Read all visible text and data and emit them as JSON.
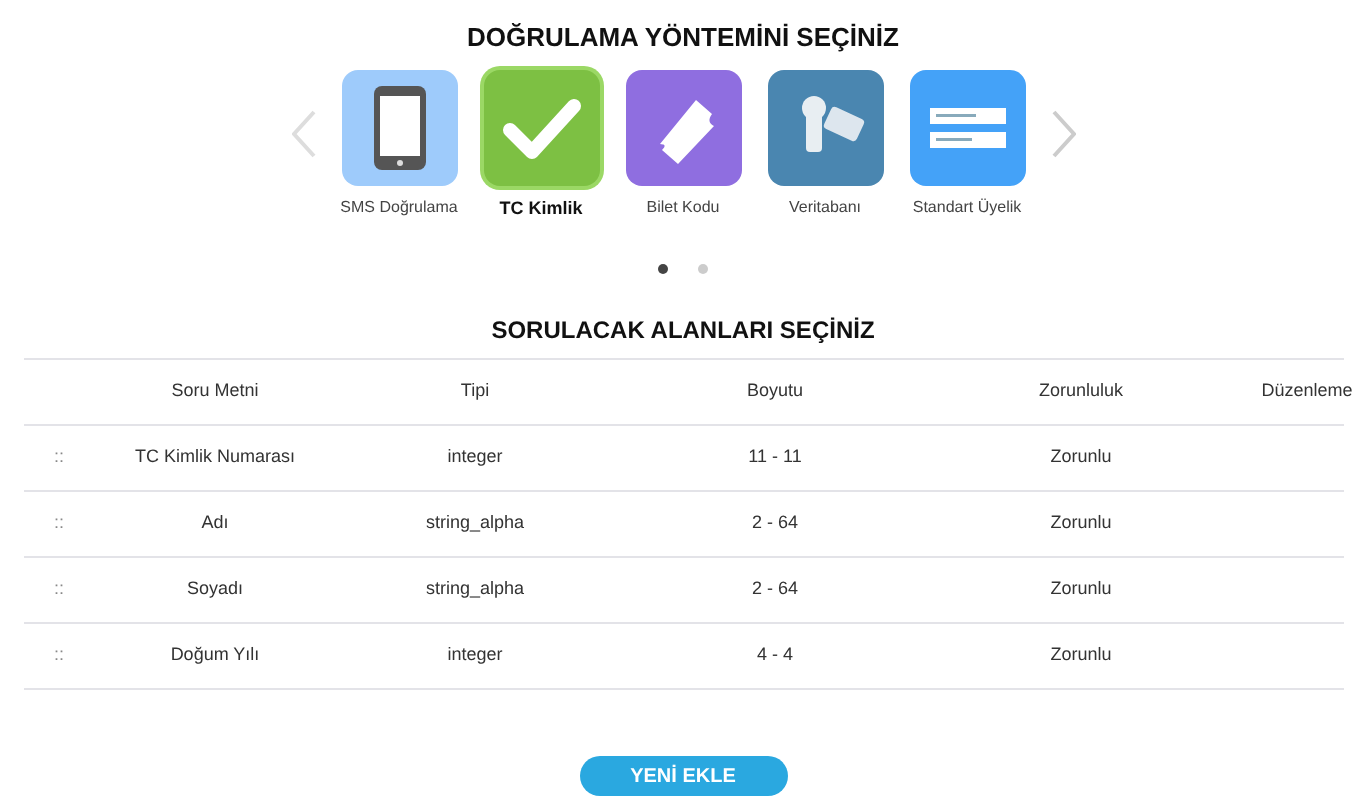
{
  "method_title": "DOĞRULAMA YÖNTEMİNİ SEÇİNİZ",
  "methods": [
    {
      "kind": "phone",
      "label": "SMS Doğrulama",
      "selected": false
    },
    {
      "kind": "check",
      "label": "TC Kimlik",
      "selected": true
    },
    {
      "kind": "ticket",
      "label": "Bilet Kodu",
      "selected": false
    },
    {
      "kind": "keys",
      "label": "Veritabanı",
      "selected": false
    },
    {
      "kind": "form",
      "label": "Standart Üyelik",
      "selected": false
    }
  ],
  "pages": [
    {
      "selected": true
    },
    {
      "selected": false
    }
  ],
  "fields_title": "SORULACAK ALANLARI SEÇİNİZ",
  "table": {
    "columns": [
      "Soru Metni",
      "Tipi",
      "Boyutu",
      "Zorunluluk",
      "Düzenleme"
    ],
    "rows": [
      {
        "handle": "::",
        "cells": [
          "TC Kimlik Numarası",
          "integer",
          "11 - 11",
          "Zorunlu"
        ]
      },
      {
        "handle": "::",
        "cells": [
          "Adı",
          "string_alpha",
          "2 - 64",
          "Zorunlu"
        ]
      },
      {
        "handle": "::",
        "cells": [
          "Soyadı",
          "string_alpha",
          "2 - 64",
          "Zorunlu"
        ]
      },
      {
        "handle": "::",
        "cells": [
          "Doğum Yılı",
          "integer",
          "4 - 4",
          "Zorunlu"
        ]
      }
    ]
  },
  "add_button": "YENİ EKLE"
}
